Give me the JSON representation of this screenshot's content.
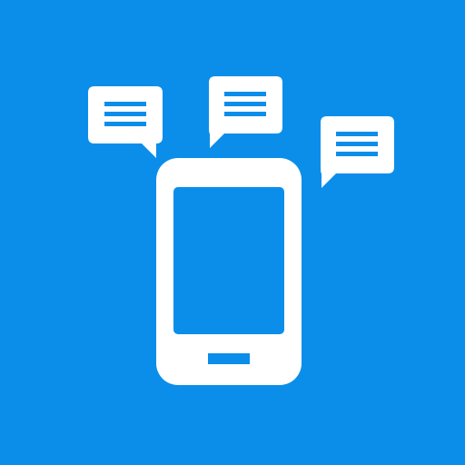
{
  "icon": {
    "name": "phone-with-message-bubbles-icon",
    "background_color": "#0B8EEA",
    "foreground_color": "#FFFFFF",
    "message_bubble_count": 3,
    "lines_per_bubble": 3
  }
}
